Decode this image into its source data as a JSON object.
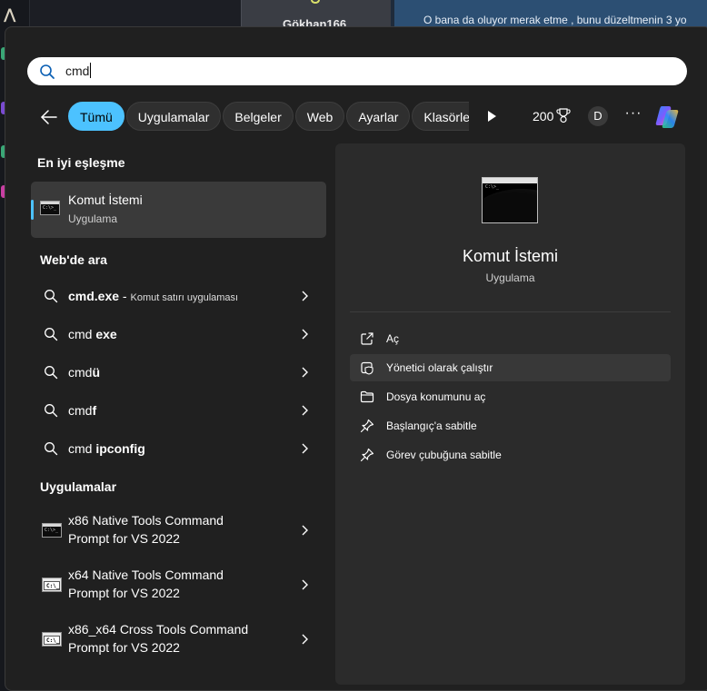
{
  "background": {
    "user_name": "Gökhan166",
    "chat_text_before": "O bana da oluyor merak etme",
    "chat_text_after": ", bunu düzeltmenin 3 yo"
  },
  "search": {
    "query": "cmd"
  },
  "filters": {
    "chips": [
      "Tümü",
      "Uygulamalar",
      "Belgeler",
      "Web",
      "Ayarlar",
      "Klasörler"
    ],
    "active": "Tümü"
  },
  "header": {
    "points": "200",
    "avatar_initial": "D",
    "more_label": "···"
  },
  "best_match": {
    "section_title": "En iyi eşleşme",
    "name": "Komut İstemi",
    "type": "Uygulama"
  },
  "web": {
    "section_title": "Web'de ara",
    "items": [
      {
        "bold": "cmd.exe",
        "suffix": " - ",
        "sub": "Komut satırı uygulaması"
      },
      {
        "normal": "cmd ",
        "bold": "exe"
      },
      {
        "normal": "cmd",
        "bold": "ü"
      },
      {
        "normal": "cmd",
        "bold": "f"
      },
      {
        "normal": "cmd ",
        "bold": "ipconfig"
      }
    ]
  },
  "apps": {
    "section_title": "Uygulamalar",
    "items": [
      {
        "line1": "x86 Native Tools Command",
        "line2": "Prompt for VS 2022"
      },
      {
        "line1": "x64 Native Tools Command",
        "line2": "Prompt for VS 2022"
      },
      {
        "line1": "x86_x64 Cross Tools Command",
        "line2": "Prompt for VS 2022"
      }
    ]
  },
  "preview": {
    "name": "Komut İstemi",
    "type": "Uygulama",
    "actions": [
      {
        "label": "Aç",
        "icon": "open-external-icon"
      },
      {
        "label": "Yönetici olarak çalıştır",
        "icon": "shield-icon"
      },
      {
        "label": "Dosya konumunu aç",
        "icon": "folder-icon"
      },
      {
        "label": "Başlangıç'a sabitle",
        "icon": "pin-icon"
      },
      {
        "label": "Görev çubuğuna sabitle",
        "icon": "pin-icon"
      }
    ]
  },
  "colors": {
    "accent": "#4cc2ff",
    "flyout_bg": "#202020",
    "preview_bg": "#2b2b2b",
    "selected_bg": "#3a3a3a"
  }
}
